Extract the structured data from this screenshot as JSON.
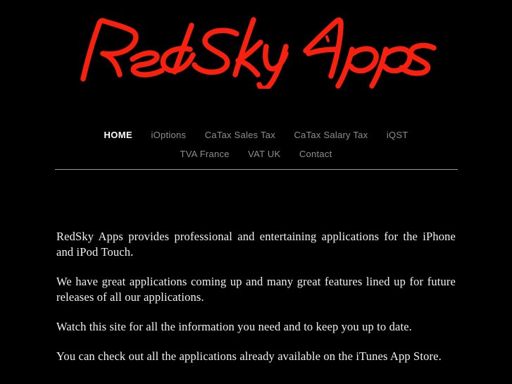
{
  "site": {
    "logo_text": "RedSky Apps",
    "logo_color": "#f8200e",
    "background_color": "#000000",
    "body_text_color": "#f2f2f2",
    "nav_inactive_color": "#8e8e8e",
    "nav_active_color": "#ffffff",
    "divider_color": "#9a9a9a"
  },
  "nav": {
    "rows": [
      {
        "items": [
          {
            "label": "HOME",
            "active": true
          },
          {
            "label": "iOptions",
            "active": false
          },
          {
            "label": "CaTax Sales Tax",
            "active": false
          },
          {
            "label": "CaTax Salary Tax",
            "active": false
          },
          {
            "label": "iQST",
            "active": false
          }
        ]
      },
      {
        "items": [
          {
            "label": "TVA France",
            "active": false
          },
          {
            "label": "VAT UK",
            "active": false
          },
          {
            "label": "Contact",
            "active": false
          }
        ]
      }
    ]
  },
  "content": {
    "paragraphs": [
      "RedSky Apps provides professional and entertaining applications for the iPhone and iPod Touch.",
      "We have great applications coming up and many great features lined up for future releases of all our applications.",
      "Watch this site for all the information you need and to keep you up to date.",
      "You can check out all the applications already available on the iTunes App Store."
    ]
  }
}
